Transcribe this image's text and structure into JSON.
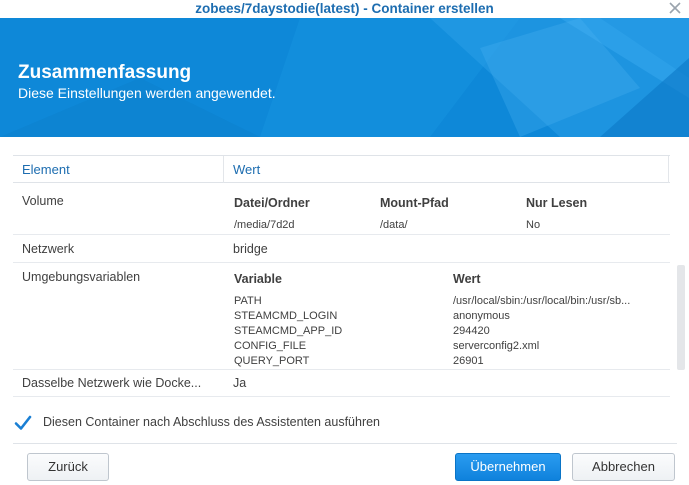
{
  "window": {
    "title": "zobees/7daystodie(latest) - Container erstellen"
  },
  "header": {
    "title": "Zusammenfassung",
    "subtitle": "Diese Einstellungen werden angewendet."
  },
  "table": {
    "columns": [
      "Element",
      "Wert"
    ],
    "volume": {
      "label": "Volume",
      "headers": [
        "Datei/Ordner",
        "Mount-Pfad",
        "Nur Lesen"
      ],
      "row": [
        "/media/7d2d",
        "/data/",
        "No"
      ]
    },
    "network": {
      "label": "Netzwerk",
      "value": "bridge"
    },
    "env": {
      "label": "Umgebungsvariablen",
      "headers": [
        "Variable",
        "Wert"
      ],
      "rows": [
        [
          "PATH",
          "/usr/local/sbin:/usr/local/bin:/usr/sb..."
        ],
        [
          "STEAMCMD_LOGIN",
          "anonymous"
        ],
        [
          "STEAMCMD_APP_ID",
          "294420"
        ],
        [
          "CONFIG_FILE",
          "serverconfig2.xml"
        ],
        [
          "QUERY_PORT",
          "26901"
        ]
      ]
    },
    "same_network": {
      "label": "Dasselbe Netzwerk wie Docke...",
      "value": "Ja"
    }
  },
  "options": {
    "run_after_wizard_label": "Diesen Container nach Abschluss des Assistenten ausführen",
    "run_after_wizard_checked": true
  },
  "buttons": {
    "back": "Zurück",
    "apply": "Übernehmen",
    "cancel": "Abbrechen"
  },
  "colors": {
    "accent": "#0e88d8",
    "link_blue": "#1d6db0"
  },
  "icons": {
    "close": "close-icon",
    "checkbox": "check-icon"
  }
}
